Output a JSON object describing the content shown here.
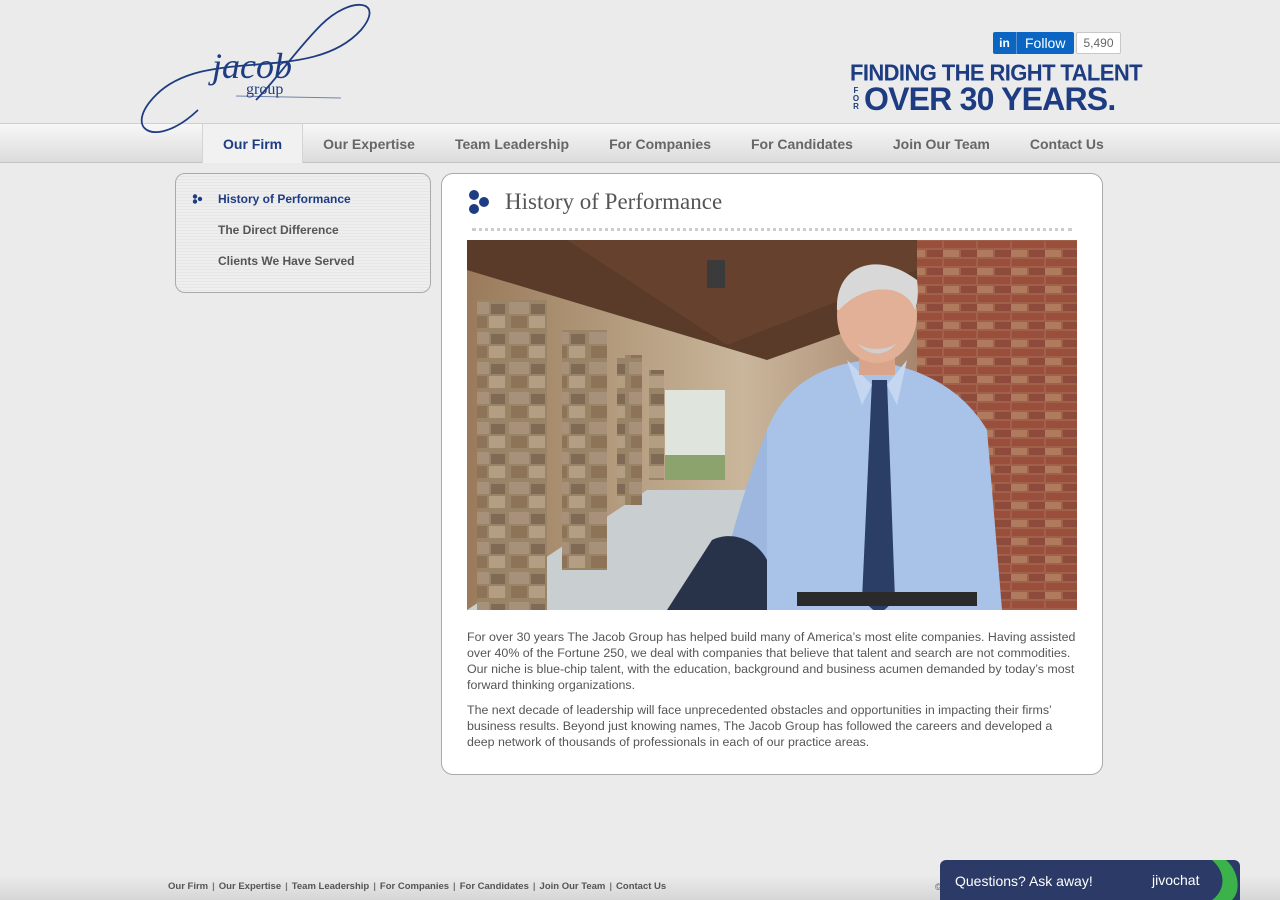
{
  "header": {
    "logo_word": "jacob",
    "logo_sub": "group",
    "linkedin": {
      "icon": "in",
      "label": "Follow",
      "count": "5,490"
    },
    "tagline": {
      "line1": "FINDING THE RIGHT TALENT",
      "for": "FOR",
      "line2": "OVER 30 YEARS."
    }
  },
  "nav": {
    "items": [
      {
        "label": "Our Firm",
        "active": true
      },
      {
        "label": "Our Expertise"
      },
      {
        "label": "Team Leadership"
      },
      {
        "label": "For Companies"
      },
      {
        "label": "For Candidates"
      },
      {
        "label": "Join Our Team"
      },
      {
        "label": "Contact Us"
      }
    ]
  },
  "sidebar": {
    "items": [
      {
        "label": "History of Performance",
        "active": true
      },
      {
        "label": "The Direct Difference"
      },
      {
        "label": "Clients We Have Served"
      }
    ]
  },
  "main": {
    "title": "History of Performance",
    "paragraphs": [
      "For over 30 years The Jacob Group has helped build many of America’s most elite companies. Having assisted over 40% of the Fortune 250, we deal with companies that believe that talent and search are not commodities. Our niche is blue-chip talent, with the education, background and business acumen demanded by today’s most forward thinking organizations.",
      "The next decade of leadership will face unprecedented obstacles and opportunities in impacting their firms’ business results. Beyond just knowing names, The Jacob Group has followed the careers and developed a deep network of thousands of professionals in each of our practice areas."
    ]
  },
  "footer": {
    "links": [
      "Our Firm",
      "Our Expertise",
      "Team Leadership",
      "For Companies",
      "For Candidates",
      "Join Our Team",
      "Contact Us"
    ],
    "separator": "|",
    "copyright": "©"
  },
  "chat": {
    "prompt": "Questions? Ask away!",
    "brand": "jivochat"
  },
  "colors": {
    "brand": "#1e3c82",
    "linkedin": "#0a66c2",
    "chat": "#2b3a67",
    "chat_leaf": "#3bb34a"
  },
  "icons": {
    "dots": "three-dots-icon",
    "linkedin": "linkedin-icon",
    "chat_leaf": "jivochat-leaf-icon"
  }
}
